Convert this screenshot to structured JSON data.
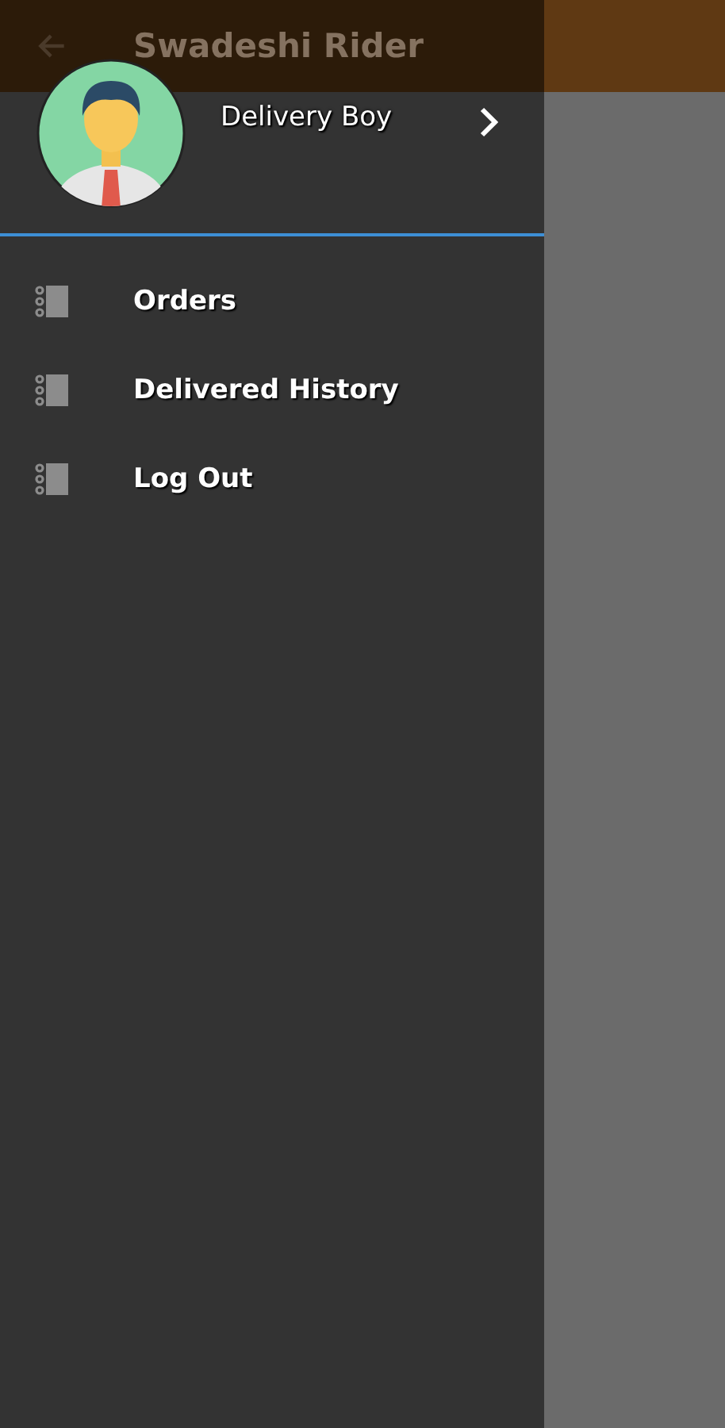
{
  "app_bar": {
    "title": "Swadeshi Rider"
  },
  "drawer": {
    "profile": {
      "name": "Delivery Boy"
    },
    "menu": [
      {
        "label": "Orders"
      },
      {
        "label": "Delivered History"
      },
      {
        "label": "Log Out"
      }
    ]
  }
}
